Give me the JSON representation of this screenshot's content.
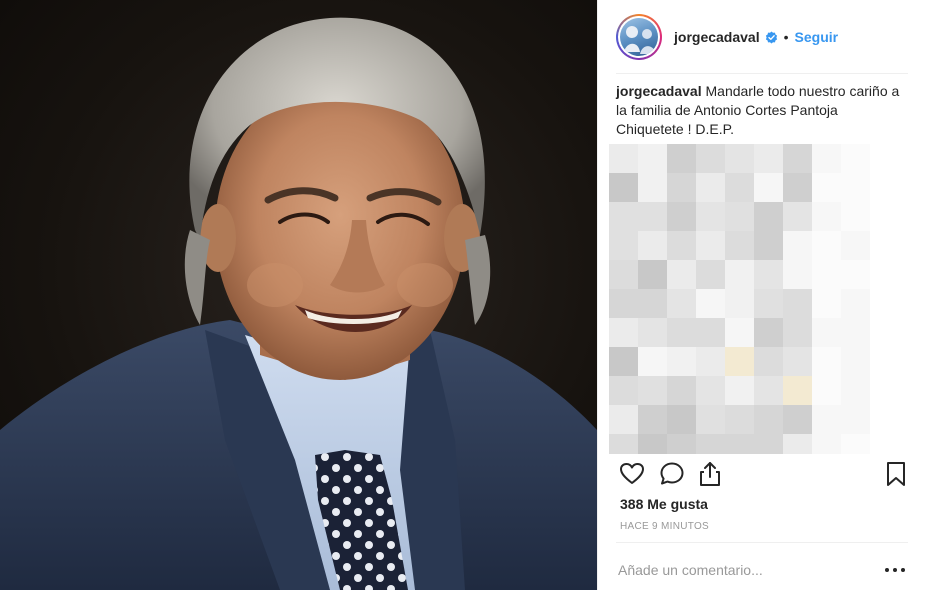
{
  "post": {
    "username": "jorgecadaval",
    "separator": "•",
    "follow_label": "Seguir",
    "caption_user": "jorgecadaval",
    "caption_text": "Mandarle todo nuestro cariño a la familia de Antonio Cortes Pantoja Chiquetete ! D.E.P.",
    "likes": "388 Me gusta",
    "time_ago": "HACE 9 MINUTOS"
  },
  "comment": {
    "placeholder": "Añade un comentario..."
  },
  "icons": {
    "verified": "verified-badge-icon",
    "like": "heart-icon",
    "comment": "comment-bubble-icon",
    "share": "share-icon",
    "save": "bookmark-icon",
    "more": "more-options-icon"
  },
  "colors": {
    "accent": "#3897f0",
    "text": "#262626",
    "muted": "#999999",
    "divider": "#efefef"
  }
}
